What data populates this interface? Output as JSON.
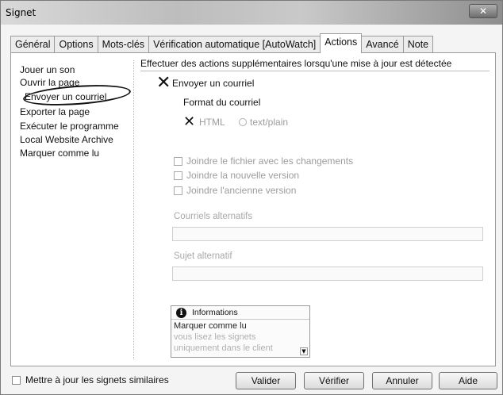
{
  "window": {
    "title": "Signet"
  },
  "tabs": [
    "Général",
    "Options",
    "Mots-clés",
    "Vérification automatique [AutoWatch]",
    "Actions",
    "Avancé",
    "Note"
  ],
  "active_tab": "Actions",
  "actions": {
    "items": [
      "Jouer un son",
      "Ouvrir la page",
      "Envoyer un courriel",
      "Exporter la page",
      "Exécuter le programme",
      "Local Website Archive",
      "Marquer comme lu"
    ],
    "selected": "Envoyer un courriel"
  },
  "heading": "Effectuer des actions supplémentaires lorsqu'une mise à jour est détectée",
  "email": {
    "enable_label": "Envoyer un courriel",
    "enabled": true,
    "format_label": "Format du courriel",
    "format_html": "HTML",
    "format_text": "text/plain",
    "selected_format": "HTML",
    "attach_changes": "Joindre le fichier avec les changements",
    "attach_new": "Joindre la nouvelle version",
    "attach_old": "Joindre l'ancienne version",
    "recipients_label": "Courriels alternatifs",
    "recipients_value": "",
    "subject_label": "Sujet alternatif",
    "subject_value": ""
  },
  "info": {
    "title": "Informations",
    "lines": [
      "Marquer comme lu",
      "vous lisez les signets",
      "uniquement dans le client"
    ]
  },
  "footer": {
    "similar_label": "Mettre à jour les signets similaires",
    "buttons": {
      "ok": "Valider",
      "check": "Vérifier",
      "cancel": "Annuler",
      "help": "Aide"
    }
  }
}
